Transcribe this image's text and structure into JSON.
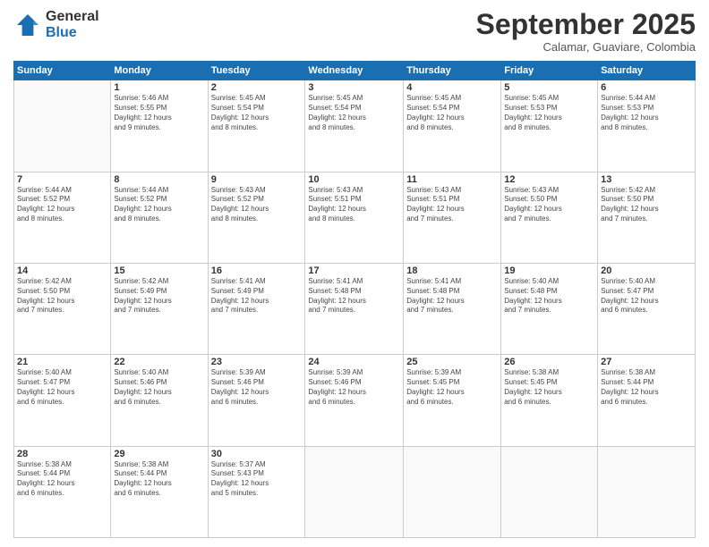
{
  "logo": {
    "general": "General",
    "blue": "Blue"
  },
  "title": "September 2025",
  "subtitle": "Calamar, Guaviare, Colombia",
  "days_header": [
    "Sunday",
    "Monday",
    "Tuesday",
    "Wednesday",
    "Thursday",
    "Friday",
    "Saturday"
  ],
  "weeks": [
    [
      {
        "day": "",
        "info": ""
      },
      {
        "day": "1",
        "info": "Sunrise: 5:46 AM\nSunset: 5:55 PM\nDaylight: 12 hours\nand 9 minutes."
      },
      {
        "day": "2",
        "info": "Sunrise: 5:45 AM\nSunset: 5:54 PM\nDaylight: 12 hours\nand 8 minutes."
      },
      {
        "day": "3",
        "info": "Sunrise: 5:45 AM\nSunset: 5:54 PM\nDaylight: 12 hours\nand 8 minutes."
      },
      {
        "day": "4",
        "info": "Sunrise: 5:45 AM\nSunset: 5:54 PM\nDaylight: 12 hours\nand 8 minutes."
      },
      {
        "day": "5",
        "info": "Sunrise: 5:45 AM\nSunset: 5:53 PM\nDaylight: 12 hours\nand 8 minutes."
      },
      {
        "day": "6",
        "info": "Sunrise: 5:44 AM\nSunset: 5:53 PM\nDaylight: 12 hours\nand 8 minutes."
      }
    ],
    [
      {
        "day": "7",
        "info": "Sunrise: 5:44 AM\nSunset: 5:52 PM\nDaylight: 12 hours\nand 8 minutes."
      },
      {
        "day": "8",
        "info": "Sunrise: 5:44 AM\nSunset: 5:52 PM\nDaylight: 12 hours\nand 8 minutes."
      },
      {
        "day": "9",
        "info": "Sunrise: 5:43 AM\nSunset: 5:52 PM\nDaylight: 12 hours\nand 8 minutes."
      },
      {
        "day": "10",
        "info": "Sunrise: 5:43 AM\nSunset: 5:51 PM\nDaylight: 12 hours\nand 8 minutes."
      },
      {
        "day": "11",
        "info": "Sunrise: 5:43 AM\nSunset: 5:51 PM\nDaylight: 12 hours\nand 7 minutes."
      },
      {
        "day": "12",
        "info": "Sunrise: 5:43 AM\nSunset: 5:50 PM\nDaylight: 12 hours\nand 7 minutes."
      },
      {
        "day": "13",
        "info": "Sunrise: 5:42 AM\nSunset: 5:50 PM\nDaylight: 12 hours\nand 7 minutes."
      }
    ],
    [
      {
        "day": "14",
        "info": "Sunrise: 5:42 AM\nSunset: 5:50 PM\nDaylight: 12 hours\nand 7 minutes."
      },
      {
        "day": "15",
        "info": "Sunrise: 5:42 AM\nSunset: 5:49 PM\nDaylight: 12 hours\nand 7 minutes."
      },
      {
        "day": "16",
        "info": "Sunrise: 5:41 AM\nSunset: 5:49 PM\nDaylight: 12 hours\nand 7 minutes."
      },
      {
        "day": "17",
        "info": "Sunrise: 5:41 AM\nSunset: 5:48 PM\nDaylight: 12 hours\nand 7 minutes."
      },
      {
        "day": "18",
        "info": "Sunrise: 5:41 AM\nSunset: 5:48 PM\nDaylight: 12 hours\nand 7 minutes."
      },
      {
        "day": "19",
        "info": "Sunrise: 5:40 AM\nSunset: 5:48 PM\nDaylight: 12 hours\nand 7 minutes."
      },
      {
        "day": "20",
        "info": "Sunrise: 5:40 AM\nSunset: 5:47 PM\nDaylight: 12 hours\nand 6 minutes."
      }
    ],
    [
      {
        "day": "21",
        "info": "Sunrise: 5:40 AM\nSunset: 5:47 PM\nDaylight: 12 hours\nand 6 minutes."
      },
      {
        "day": "22",
        "info": "Sunrise: 5:40 AM\nSunset: 5:46 PM\nDaylight: 12 hours\nand 6 minutes."
      },
      {
        "day": "23",
        "info": "Sunrise: 5:39 AM\nSunset: 5:46 PM\nDaylight: 12 hours\nand 6 minutes."
      },
      {
        "day": "24",
        "info": "Sunrise: 5:39 AM\nSunset: 5:46 PM\nDaylight: 12 hours\nand 6 minutes."
      },
      {
        "day": "25",
        "info": "Sunrise: 5:39 AM\nSunset: 5:45 PM\nDaylight: 12 hours\nand 6 minutes."
      },
      {
        "day": "26",
        "info": "Sunrise: 5:38 AM\nSunset: 5:45 PM\nDaylight: 12 hours\nand 6 minutes."
      },
      {
        "day": "27",
        "info": "Sunrise: 5:38 AM\nSunset: 5:44 PM\nDaylight: 12 hours\nand 6 minutes."
      }
    ],
    [
      {
        "day": "28",
        "info": "Sunrise: 5:38 AM\nSunset: 5:44 PM\nDaylight: 12 hours\nand 6 minutes."
      },
      {
        "day": "29",
        "info": "Sunrise: 5:38 AM\nSunset: 5:44 PM\nDaylight: 12 hours\nand 6 minutes."
      },
      {
        "day": "30",
        "info": "Sunrise: 5:37 AM\nSunset: 5:43 PM\nDaylight: 12 hours\nand 5 minutes."
      },
      {
        "day": "",
        "info": ""
      },
      {
        "day": "",
        "info": ""
      },
      {
        "day": "",
        "info": ""
      },
      {
        "day": "",
        "info": ""
      }
    ]
  ]
}
